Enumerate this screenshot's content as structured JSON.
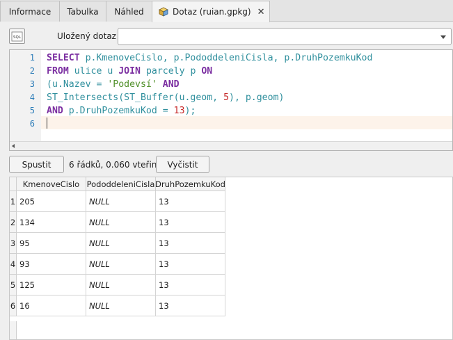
{
  "tabs": [
    {
      "label": "Informace"
    },
    {
      "label": "Tabulka"
    },
    {
      "label": "Náhled"
    },
    {
      "label": "Dotaz (ruian.gpkg)"
    }
  ],
  "tab_close_glyph": "✕",
  "saved_query": {
    "label": "Uložený dotaz",
    "value": ""
  },
  "sql_icon_text": "SQL",
  "editor": {
    "line_numbers": [
      "1",
      "2",
      "3",
      "4",
      "5",
      "6"
    ],
    "lines": [
      [
        {
          "t": "kw",
          "v": "SELECT"
        },
        {
          "t": "id",
          "v": " p.KmenoveCislo, p.PododdeleniCisla, p.DruhPozemkuKod"
        }
      ],
      [
        {
          "t": "kw",
          "v": "FROM"
        },
        {
          "t": "id",
          "v": " ulice u "
        },
        {
          "t": "kw",
          "v": "JOIN"
        },
        {
          "t": "id",
          "v": " parcely p "
        },
        {
          "t": "kw",
          "v": "ON"
        }
      ],
      [
        {
          "t": "id",
          "v": "(u.Nazev = "
        },
        {
          "t": "str",
          "v": "'Podevsí'"
        },
        {
          "t": "id",
          "v": " "
        },
        {
          "t": "kw",
          "v": "AND"
        }
      ],
      [
        {
          "t": "id",
          "v": "ST_Intersects(ST_Buffer(u.geom, "
        },
        {
          "t": "num",
          "v": "5"
        },
        {
          "t": "id",
          "v": "), p.geom)"
        }
      ],
      [
        {
          "t": "kw",
          "v": "AND"
        },
        {
          "t": "id",
          "v": " p.DruhPozemkuKod = "
        },
        {
          "t": "num",
          "v": "13"
        },
        {
          "t": "id",
          "v": ");"
        }
      ],
      []
    ]
  },
  "run_button": "Spustit",
  "status": "6 řádků, 0.060 vteřin",
  "clear_button": "Vyčistit",
  "results": {
    "columns": [
      "KmenoveCislo",
      "PododdeleniCisla",
      "DruhPozemkuKod"
    ],
    "rows": [
      {
        "num": "1",
        "cells": [
          "205",
          "NULL",
          "13"
        ]
      },
      {
        "num": "2",
        "cells": [
          "134",
          "NULL",
          "13"
        ]
      },
      {
        "num": "3",
        "cells": [
          "95",
          "NULL",
          "13"
        ]
      },
      {
        "num": "4",
        "cells": [
          "93",
          "NULL",
          "13"
        ]
      },
      {
        "num": "5",
        "cells": [
          "125",
          "NULL",
          "13"
        ]
      },
      {
        "num": "6",
        "cells": [
          "16",
          "NULL",
          "13"
        ]
      }
    ]
  },
  "colors": {
    "keyword": "#7b2fa1",
    "identifier": "#2f8f9d",
    "string": "#4f8f28",
    "number": "#c62828",
    "line_number": "#2b7cb8"
  }
}
